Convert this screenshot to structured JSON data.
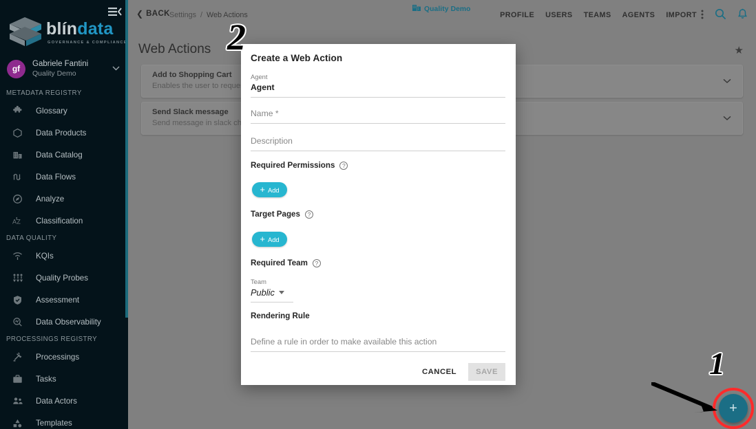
{
  "sidebar": {
    "collapse_icon": "menu-collapse-icon",
    "logo": {
      "word_1": "blín",
      "word_2": "data",
      "tagline": "GOVERNANCE & COMPLIANCE"
    },
    "user": {
      "initials": "gf",
      "name": "Gabriele Fantini",
      "org": "Quality Demo",
      "chevron": "▼"
    },
    "sections": [
      {
        "title": "METADATA REGISTRY",
        "items": [
          {
            "label": "Glossary",
            "icon": "puzzle-icon"
          },
          {
            "label": "Data Products",
            "icon": "hexagon-icon"
          },
          {
            "label": "Data Catalog",
            "icon": "building-icon"
          },
          {
            "label": "Data Flows",
            "icon": "flows-icon"
          },
          {
            "label": "Analyze",
            "icon": "compass-icon"
          },
          {
            "label": "Classification",
            "icon": "az-sort-icon"
          }
        ]
      },
      {
        "title": "DATA QUALITY",
        "items": [
          {
            "label": "KQIs",
            "icon": "signal-icon"
          },
          {
            "label": "Quality Probes",
            "icon": "probes-icon"
          },
          {
            "label": "Assessment",
            "icon": "shield-check-icon"
          },
          {
            "label": "Data Observability",
            "icon": "magnifier-chart-icon"
          }
        ]
      },
      {
        "title": "PROCESSINGS REGISTRY",
        "items": [
          {
            "label": "Processings",
            "icon": "gavel-icon"
          },
          {
            "label": "Tasks",
            "icon": "briefcase-icon"
          },
          {
            "label": "Data Actors",
            "icon": "people-icon"
          },
          {
            "label": "Templates",
            "icon": "shapes-icon"
          }
        ]
      }
    ]
  },
  "topbar": {
    "back_label": "BACK",
    "back_chevron": "❮",
    "breadcrumb": {
      "parent": "Settings",
      "separator": "/",
      "current": "Web Actions"
    },
    "tenant": {
      "label": "Quality Demo",
      "icon": "tenant-building-icon"
    },
    "links": [
      "PROFILE",
      "USERS",
      "TEAMS",
      "AGENTS",
      "IMPORT"
    ],
    "icons": [
      "more-vertical-icon",
      "search-icon",
      "notifications-bell-icon"
    ]
  },
  "page": {
    "title": "Web Actions",
    "favorite_icon": "★",
    "cards": [
      {
        "title": "Add to Shopping Cart",
        "subtitle": "Enables the user to request",
        "chevron": "⌄"
      },
      {
        "title": "Send Slack message",
        "subtitle": "Send message in slack chan",
        "chevron": "⌄"
      }
    ],
    "fab": {
      "label": "+",
      "name": "add-web-action-fab"
    }
  },
  "modal": {
    "title": "Create a Web Action",
    "fields": {
      "agent": {
        "label": "Agent",
        "value": "Agent"
      },
      "name": {
        "placeholder": "Name *"
      },
      "description": {
        "placeholder": "Description"
      }
    },
    "sections": {
      "required_permissions": {
        "title": "Required Permissions",
        "help": "?",
        "add_label": "Add"
      },
      "target_pages": {
        "title": "Target Pages",
        "help": "?",
        "add_label": "Add"
      },
      "required_team": {
        "title": "Required Team",
        "help": "?"
      },
      "rendering_rule": {
        "title": "Rendering Rule"
      }
    },
    "team_select": {
      "label": "Team",
      "value": "Public"
    },
    "rendering_rule_placeholder": "Define a rule in order to make available this action",
    "actions": {
      "cancel": "CANCEL",
      "save": "SAVE"
    }
  },
  "annotations": {
    "marker_1": "1",
    "marker_2": "2"
  },
  "colors": {
    "sidebar_bg": "#04131a",
    "accent_teal": "#1b6e85",
    "add_button": "#27b6d0",
    "annotation_red": "#ff2b2b",
    "overlay_gray": "#808080",
    "avatar_purple": "#8e2a8e"
  }
}
